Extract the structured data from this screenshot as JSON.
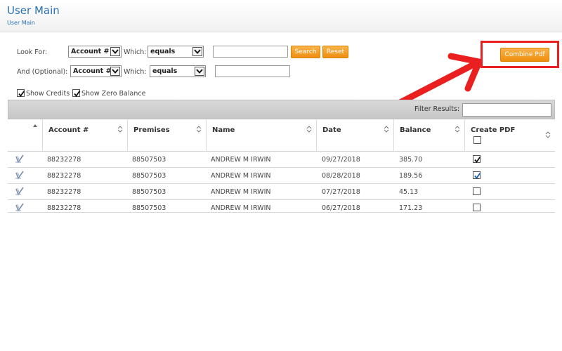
{
  "header": {
    "title": "User Main",
    "breadcrumb": "User Main"
  },
  "search": {
    "look_for_label": "Look For:",
    "and_optional_label": "And (Optional):",
    "which_label": "Which:",
    "field1": "Account #",
    "which1": "equals",
    "field2": "Account #",
    "which2": "equals",
    "value1": "",
    "value2": "",
    "search_button": "Search",
    "reset_button": "Reset"
  },
  "combine_pdf_button": "Combine Pdf",
  "options": {
    "show_credits_label": "Show Credits",
    "show_credits_checked": true,
    "show_zero_balance_label": "Show Zero Balance",
    "show_zero_balance_checked": true
  },
  "filter": {
    "label": "Filter Results:",
    "value": ""
  },
  "table": {
    "columns": [
      "Account #",
      "Premises",
      "Name",
      "Date",
      "Balance",
      "Create PDF"
    ],
    "select_all_checked": false,
    "rows": [
      {
        "account": "88232278",
        "premises": "88507503",
        "name": "ANDREW M IRWIN",
        "date": "09/27/2018",
        "balance": "385.70",
        "checked": true
      },
      {
        "account": "88232278",
        "premises": "88507503",
        "name": "ANDREW M IRWIN",
        "date": "08/28/2018",
        "balance": "189.56",
        "checked": true
      },
      {
        "account": "88232278",
        "premises": "88507503",
        "name": "ANDREW M IRWIN",
        "date": "07/27/2018",
        "balance": "45.13",
        "checked": false
      },
      {
        "account": "88232278",
        "premises": "88507503",
        "name": "ANDREW M IRWIN",
        "date": "06/27/2018",
        "balance": "171.23",
        "checked": false
      }
    ]
  },
  "colors": {
    "accent_blue": "#2a73b6",
    "button_orange": "#f5a12a",
    "highlight_red": "#ea2020"
  }
}
